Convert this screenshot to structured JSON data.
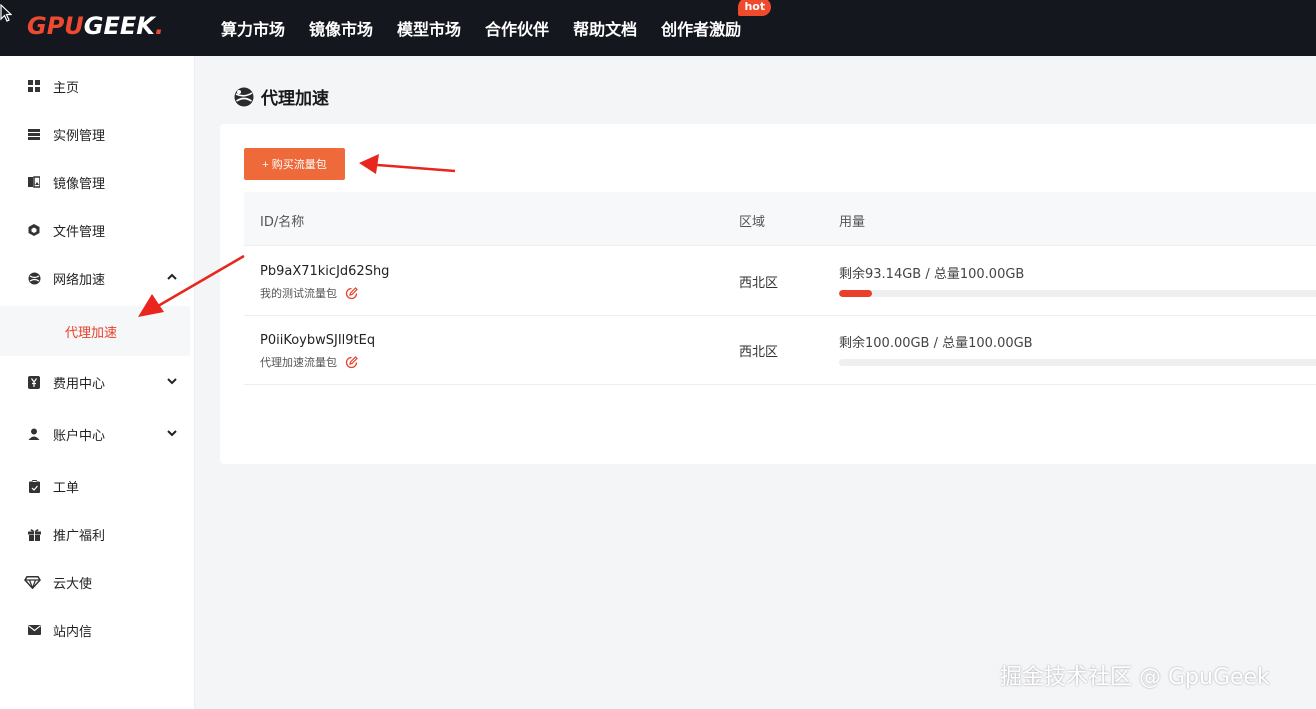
{
  "brand": {
    "gpu": "GPU",
    "geek": "GEEK",
    "dot": "."
  },
  "nav": {
    "items": [
      "算力市场",
      "镜像市场",
      "模型市场",
      "合作伙伴",
      "帮助文档",
      "创作者激励"
    ],
    "hot_badge": "hot"
  },
  "sidebar": {
    "items": [
      {
        "label": "主页",
        "icon": "grid-icon"
      },
      {
        "label": "实例管理",
        "icon": "list-icon"
      },
      {
        "label": "镜像管理",
        "icon": "image-icon"
      },
      {
        "label": "文件管理",
        "icon": "cube-icon"
      },
      {
        "label": "网络加速",
        "icon": "network-icon",
        "expanded": true
      },
      {
        "label": "费用中心",
        "icon": "yen-icon",
        "expanded": false
      },
      {
        "label": "账户中心",
        "icon": "user-icon",
        "expanded": false
      },
      {
        "label": "工单",
        "icon": "clipboard-icon"
      },
      {
        "label": "推广福利",
        "icon": "gift-icon"
      },
      {
        "label": "云大使",
        "icon": "diamond-icon"
      },
      {
        "label": "站内信",
        "icon": "mail-icon"
      }
    ],
    "sub_item": "代理加速"
  },
  "page": {
    "title": "代理加速",
    "buy_button": "+ 购买流量包"
  },
  "table": {
    "columns": [
      "ID/名称",
      "区域",
      "用量"
    ],
    "rows": [
      {
        "id": "Pb9aX71kicJd62Shg",
        "name": "我的测试流量包",
        "region": "西北区",
        "usage": "剩余93.14GB / 总量100.00GB",
        "used_fraction": 0.069
      },
      {
        "id": "P0iiKoybwSJIl9tEq",
        "name": "代理加速流量包",
        "region": "西北区",
        "usage": "剩余100.00GB / 总量100.00GB",
        "used_fraction": 0.0
      }
    ]
  },
  "watermark": "掘金技术社区 @ GpuGeek",
  "colors": {
    "accent": "#e8402a",
    "topbar": "#15171e",
    "button": "#ee6a3a"
  }
}
